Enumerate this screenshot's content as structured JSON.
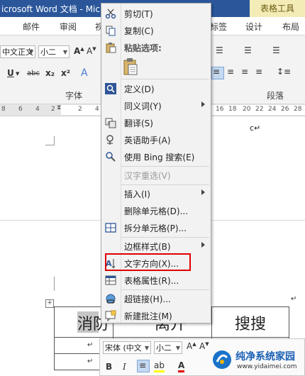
{
  "title_bar": {
    "text": "icrosoft Word 文档 - Mic",
    "context_tools_label": "表格工具"
  },
  "tabs": [
    "邮件",
    "审阅",
    "视",
    "标签",
    "设计",
    "布局"
  ],
  "ribbon": {
    "font_name": "中文正文",
    "font_size": "小二",
    "font_group_label": "字体",
    "paragraph_group_label": "段落",
    "buttons": [
      "U",
      "abc",
      "x₂",
      "x²"
    ]
  },
  "ruler": {
    "numbers": [
      "8",
      "6",
      "4",
      "2",
      "2",
      "4",
      "16",
      "18",
      "20",
      "22",
      "24",
      "26",
      "28"
    ]
  },
  "document": {
    "cells": [
      "消防",
      "离开",
      "搜搜"
    ],
    "cursor_text": "c↵",
    "table_move_handle": "+"
  },
  "context_menu": {
    "items": [
      {
        "label": "剪切(T)",
        "icon": "scissors-icon",
        "enabled": true,
        "submenu": false
      },
      {
        "label": "复制(C)",
        "icon": "copy-icon",
        "enabled": true,
        "submenu": false
      },
      {
        "label": "粘贴选项:",
        "icon": "paste-icon",
        "enabled": true,
        "submenu": false,
        "header": true
      },
      {
        "label": "定义(D)",
        "icon": "search-icon",
        "enabled": true,
        "submenu": false
      },
      {
        "label": "同义词(Y)",
        "icon": "",
        "enabled": true,
        "submenu": true
      },
      {
        "label": "翻译(S)",
        "icon": "translate-icon",
        "enabled": true,
        "submenu": false
      },
      {
        "label": "英语助手(A)",
        "icon": "assistant-icon",
        "enabled": true,
        "submenu": false
      },
      {
        "label": "使用 Bing 搜索(E)",
        "icon": "bing-search-icon",
        "enabled": true,
        "submenu": false
      },
      {
        "label": "汉字重选(V)",
        "icon": "",
        "enabled": false,
        "submenu": false
      },
      {
        "label": "插入(I)",
        "icon": "",
        "enabled": true,
        "submenu": true
      },
      {
        "label": "删除单元格(D)...",
        "icon": "",
        "enabled": true,
        "submenu": false
      },
      {
        "label": "拆分单元格(P)...",
        "icon": "split-cells-icon",
        "enabled": true,
        "submenu": false
      },
      {
        "label": "边框样式(B)",
        "icon": "",
        "enabled": true,
        "submenu": true
      },
      {
        "label": "文字方向(X)...",
        "icon": "text-direction-icon",
        "enabled": true,
        "submenu": false
      },
      {
        "label": "表格属性(R)...",
        "icon": "table-properties-icon",
        "enabled": true,
        "submenu": false
      },
      {
        "label": "超链接(H)...",
        "icon": "hyperlink-icon",
        "enabled": true,
        "submenu": false
      },
      {
        "label": "新建批注(M)",
        "icon": "new-comment-icon",
        "enabled": true,
        "submenu": false
      }
    ],
    "highlighted_item": "文字方向(X)...",
    "highlight_color": "#e00000"
  },
  "mini_toolbar": {
    "font_name": "宋体 (中文",
    "font_size": "小二",
    "buttons": [
      "B",
      "I",
      "A"
    ]
  },
  "watermark": {
    "title": "纯净系统家园",
    "url": "www.yidaimei.com"
  },
  "colors": {
    "title_bar": "#2b579a",
    "context_tools": "#f3ecb7",
    "menu_bg": "#f2f2f2",
    "highlight": "#e00000"
  }
}
